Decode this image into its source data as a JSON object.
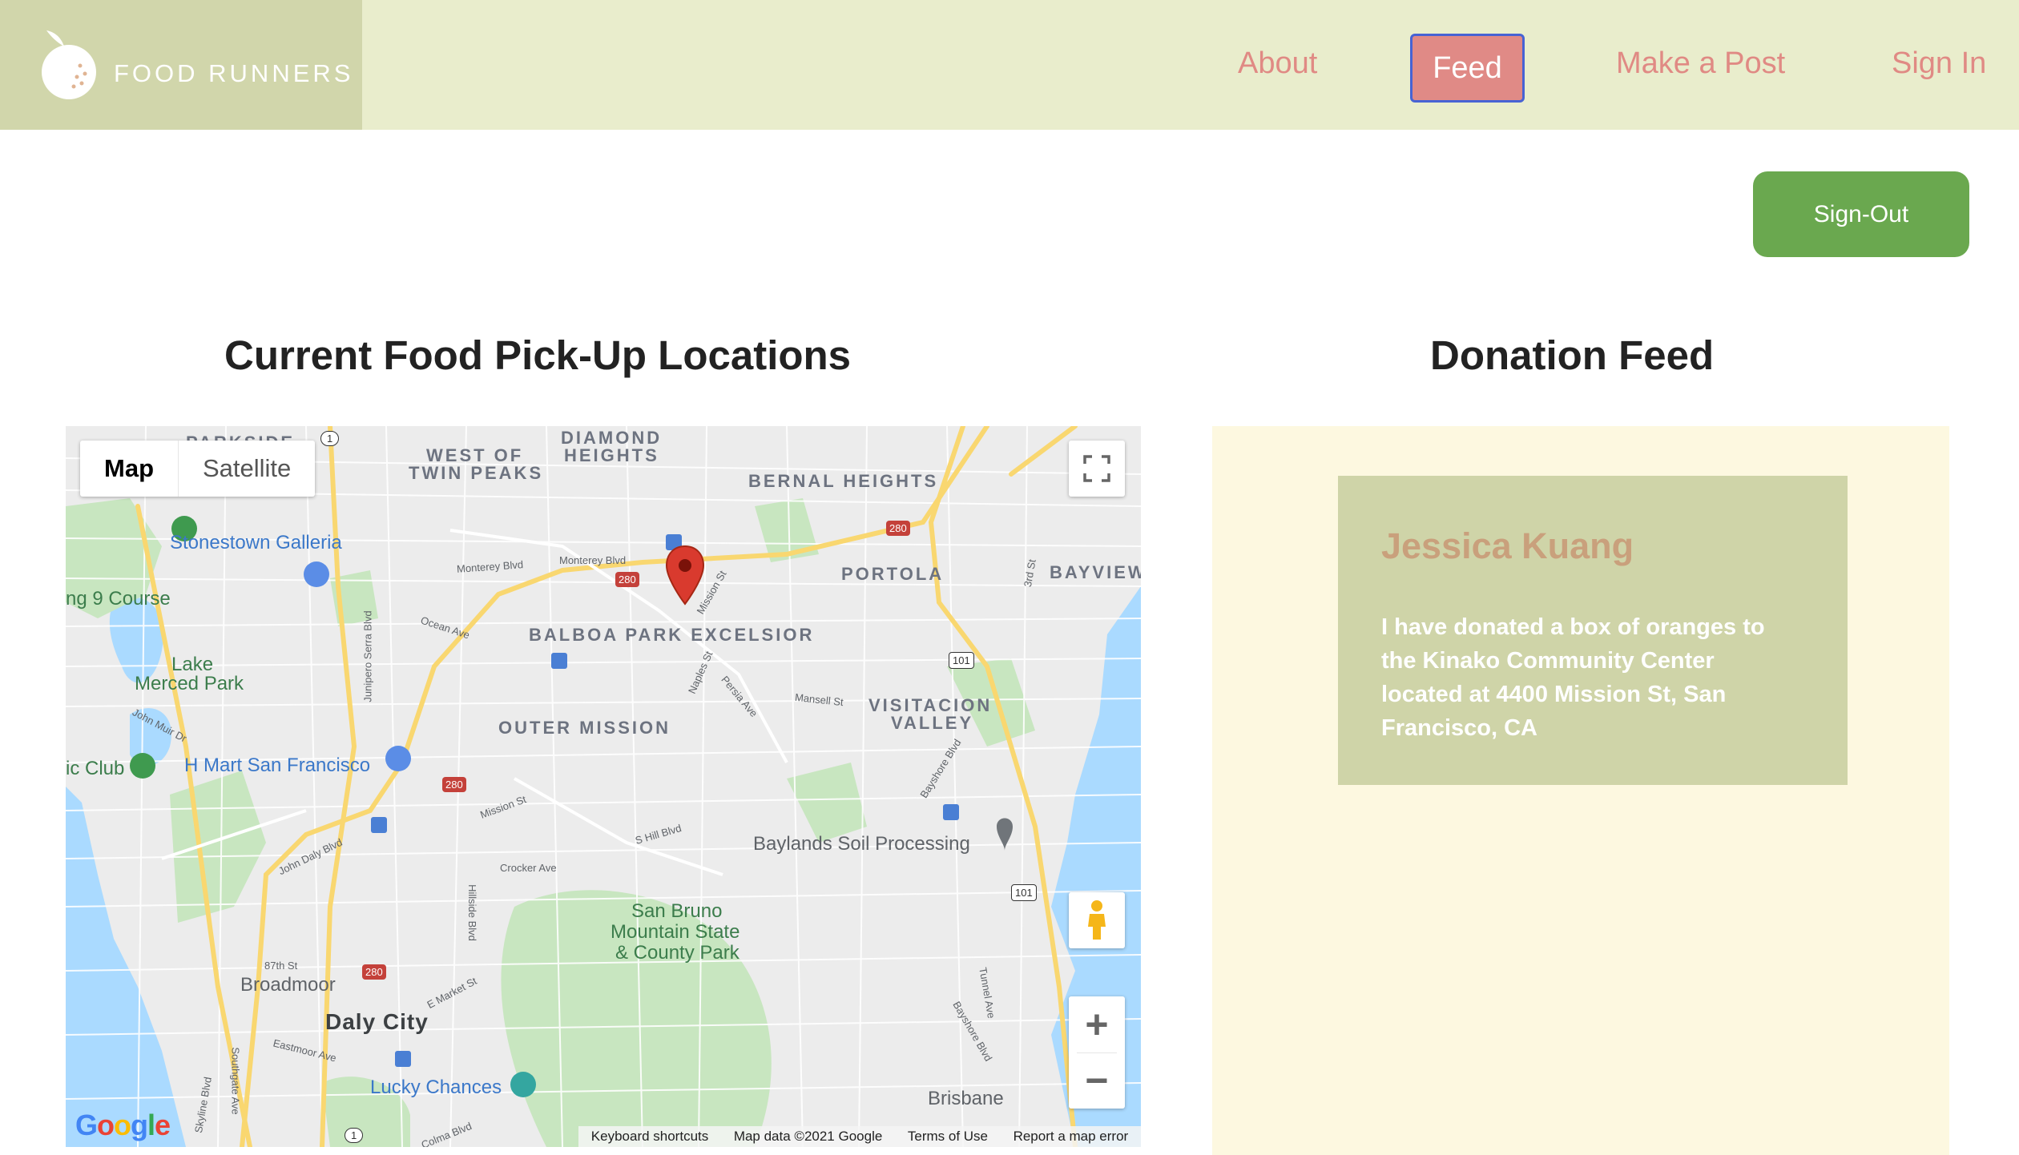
{
  "brand": {
    "name": "FOOD RUNNERS",
    "logo_icon": "peach-icon"
  },
  "nav": {
    "about": "About",
    "feed": "Feed",
    "make_post": "Make a Post",
    "sign_in": "Sign In"
  },
  "signout_label": "Sign-Out",
  "map_section": {
    "title": "Current Food Pick-Up Locations",
    "map_type": {
      "map": "Map",
      "satellite": "Satellite"
    },
    "zoom_in": "+",
    "zoom_out": "−",
    "labels": {
      "west_twin_peaks_1": "WEST OF",
      "west_twin_peaks_2": "TWIN PEAKS",
      "diamond_1": "DIAMOND",
      "diamond_2": "HEIGHTS",
      "bernal": "BERNAL HEIGHTS",
      "portola": "PORTOLA",
      "bayview": "BAYVIEW",
      "balboa": "BALBOA PARK EXCELSIOR",
      "outer_mission": "OUTER MISSION",
      "visitacion_1": "VISITACION",
      "visitacion_2": "VALLEY",
      "stonestown": "Stonestown Galleria",
      "course": "ng 9 Course",
      "lake_merced_1": "Lake",
      "lake_merced_2": "Merced Park",
      "hmart": "H Mart San Francisco",
      "ic_club": "ic Club",
      "baylands": "Baylands Soil Processing",
      "san_bruno_1": "San Bruno",
      "san_bruno_2": "Mountain State",
      "san_bruno_3": "& County Park",
      "broadmoor": "Broadmoor",
      "daly_city": "Daly City",
      "lucky": "Lucky Chances",
      "brisbane": "Brisbane",
      "monterey1": "Monterey Blvd",
      "monterey2": "Monterey Blvd",
      "mission_st": "Mission St",
      "ocean_ave": "Ocean Ave",
      "junipero": "Junipero Serra Blvd",
      "naples": "Naples St",
      "persia": "Persia Ave",
      "mansell": "Mansell St",
      "bayshore": "Bayshore Blvd",
      "mission_st2": "Mission St",
      "john_daly": "John Daly Blvd",
      "john_muir": "John Muir Dr",
      "crocker": "Crocker Ave",
      "s_hill": "S Hill Blvd",
      "hillside": "Hillside Blvd",
      "e_market": "E Market St",
      "eastmoor": "Eastmoor Ave",
      "st87": "87th St",
      "southgate": "Southgate Ave",
      "skyline": "Skyline Blvd",
      "third_st": "3rd St",
      "tunnel": "Tunnel Ave",
      "bayshore2": "Bayshore Blvd",
      "colma": "Colma Blvd",
      "parkside": "PARKSIDE",
      "route_280a": "280",
      "route_280b": "280",
      "route_280c": "280",
      "route_280d": "280",
      "route_101a": "101",
      "route_101b": "101",
      "route_1a": "1",
      "route_1b": "1"
    },
    "google_logo": [
      "G",
      "o",
      "o",
      "g",
      "l",
      "e"
    ],
    "footer": {
      "shortcuts": "Keyboard shortcuts",
      "map_data": "Map data ©2021 Google",
      "terms": "Terms of Use",
      "report": "Report a map error"
    }
  },
  "feed_section": {
    "title": "Donation Feed",
    "posts": [
      {
        "name": "Jessica Kuang",
        "text": "I have donated a box of oranges to the Kinako Community Center located at 4400 Mission St, San Francisco, CA"
      }
    ]
  },
  "colors": {
    "header_bg": "#e9edcc",
    "logo_bg": "#d1d6ab",
    "nav_text": "#e08a84",
    "feed_active_bg": "#e08a86",
    "signout_bg": "#6aa84f",
    "feed_bg": "#fdf8e0",
    "card_bg": "#cfd4a8",
    "card_name": "#c9a07c"
  }
}
